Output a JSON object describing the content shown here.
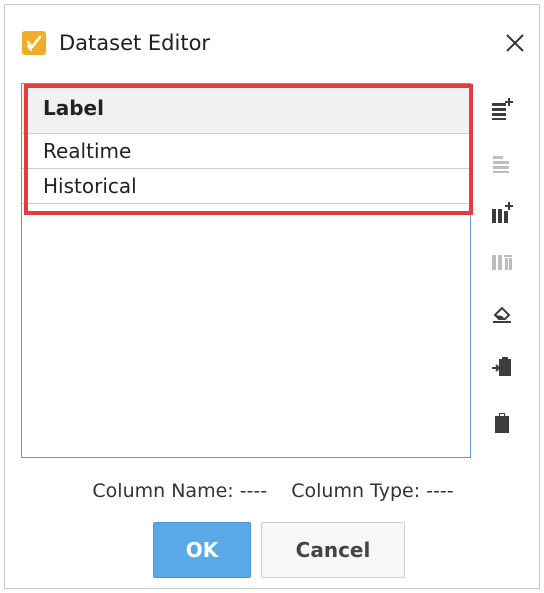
{
  "window": {
    "title": "Dataset Editor"
  },
  "table": {
    "header": "Label",
    "rows": [
      "Realtime",
      "Historical"
    ]
  },
  "footer": {
    "column_name_label": "Column Name:",
    "column_name_value": "----",
    "column_type_label": "Column Type:",
    "column_type_value": "----"
  },
  "buttons": {
    "ok": "OK",
    "cancel": "Cancel"
  },
  "toolbar": {
    "icons": [
      "add-row-icon",
      "remove-row-icon",
      "add-column-icon",
      "remove-column-icon",
      "clear-icon",
      "paste-insert-icon",
      "clipboard-icon"
    ]
  },
  "colors": {
    "ok_button": "#5aa9e6",
    "highlight": "#e63b3f",
    "table_border": "#5b9bd5",
    "app_icon": "#f0ad2a"
  }
}
